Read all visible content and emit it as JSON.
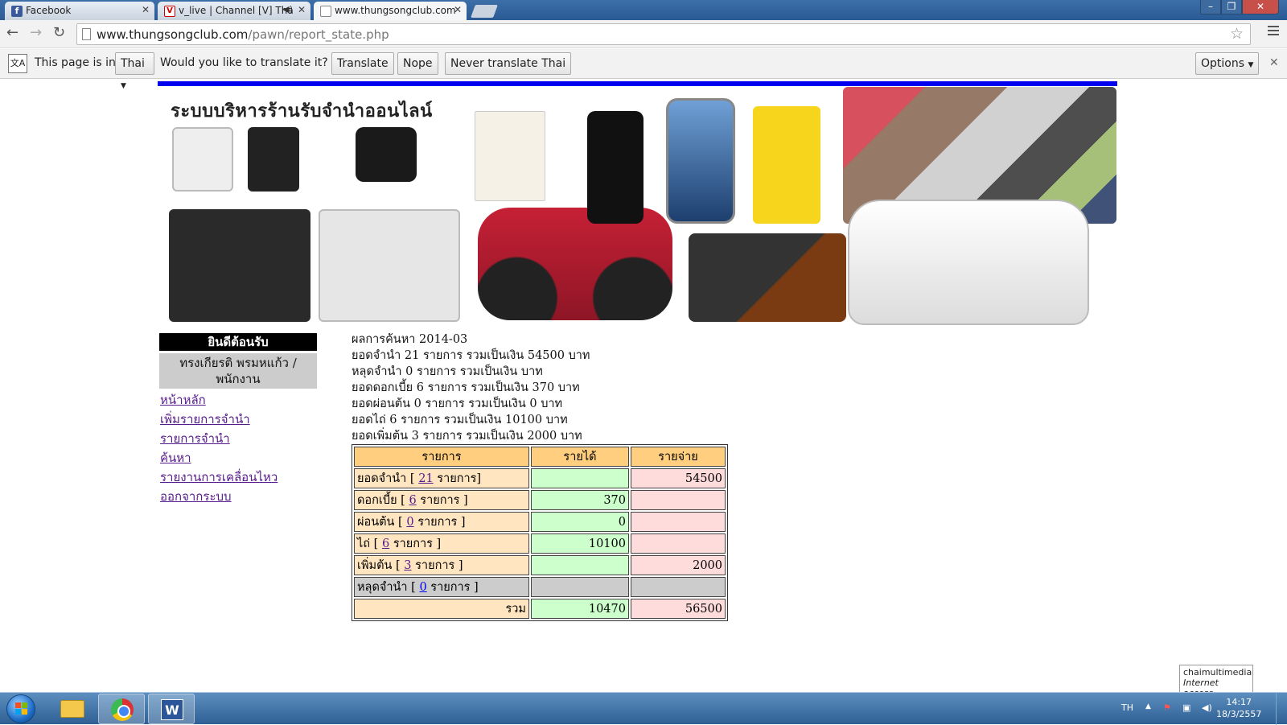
{
  "browser": {
    "tabs": [
      {
        "title": "Facebook",
        "favicon": "facebook-icon"
      },
      {
        "title": "v_live | Channel [V] Tha",
        "favicon": "channel-v-icon"
      },
      {
        "title": "www.thungsongclub.com",
        "favicon": "page-icon"
      }
    ],
    "url_host": "www.thungsongclub.com",
    "url_path": "/pawn/report_state.php",
    "translate_bar": {
      "prefix": "This page is in",
      "language": "Thai",
      "question": "Would you like to translate it?",
      "translate_label": "Translate",
      "nope_label": "Nope",
      "never_label": "Never translate Thai",
      "options_label": "Options"
    }
  },
  "banner": {
    "title": "ระบบบริหารร้านรับจำนำออนไลน์"
  },
  "sidebar": {
    "welcome": "ยินดีต้อนรับ",
    "user": "ทรงเกียรติ พรมหแก้ว / พนักงาน",
    "links": [
      "หน้าหลัก",
      "เพิ่มรายการจำนำ",
      "รายการจำนำ",
      "ค้นหา",
      "รายงานการเคลื่อนไหว",
      "ออกจากระบบ"
    ]
  },
  "summary": {
    "lines": [
      "ผลการค้นหา 2014-03",
      "ยอดจำนำ 21 รายการ รวมเป็นเงิน 54500 บาท",
      "หลุดจำนำ 0 รายการ รวมเป็นเงิน บาท",
      "ยอดดอกเบี้ย 6 รายการ รวมเป็นเงิน 370 บาท",
      "ยอดผ่อนต้น 0 รายการ รวมเป็นเงิน 0 บาท",
      "ยอดไถ่ 6 รายการ รวมเป็นเงิน 10100 บาท",
      "ยอดเพิ่มต้น 3 รายการ รวมเป็นเงิน 2000 บาท"
    ]
  },
  "report_table": {
    "headers": [
      "รายการ",
      "รายได้",
      "รายจ่าย"
    ],
    "rows": [
      {
        "label": "ยอดจำนำ",
        "count": "21",
        "unit": "รายการ]",
        "income": "",
        "expense": "54500"
      },
      {
        "label": "ดอกเบี้ย",
        "count": "6",
        "unit": "รายการ ]",
        "income": "370",
        "expense": ""
      },
      {
        "label": "ผ่อนต้น",
        "count": "0",
        "unit": "รายการ ]",
        "income": "0",
        "expense": ""
      },
      {
        "label": "ไถ่",
        "count": "6",
        "unit": "รายการ ]",
        "income": "10100",
        "expense": ""
      },
      {
        "label": "เพิ่มต้น",
        "count": "3",
        "unit": "รายการ ]",
        "income": "",
        "expense": "2000"
      },
      {
        "label": "หลุดจำนำ",
        "count": "0",
        "unit": "รายการ ]",
        "income": "",
        "expense": ""
      }
    ],
    "total_label": "รวม",
    "total_income": "10470",
    "total_expense": "56500"
  },
  "tooltip": {
    "title": "chaimultimedia",
    "subtitle": "Internet access"
  },
  "taskbar": {
    "language": "TH",
    "time": "14:17",
    "date": "18/3/2557",
    "apps": [
      "windows-explorer-icon",
      "chrome-icon",
      "word-icon"
    ]
  },
  "colors": {
    "accent_bar": "#0000ee",
    "header_cell": "#ffcf7f",
    "label_cell": "#ffe5c0",
    "income_cell": "#ccffcc",
    "expense_cell": "#ffdcdc",
    "link": "#551a8b"
  }
}
